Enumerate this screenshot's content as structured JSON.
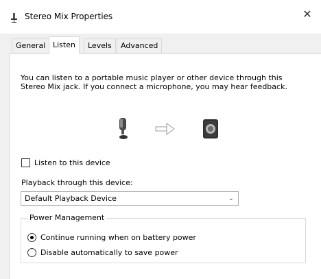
{
  "window": {
    "title": "Stereo Mix Properties",
    "close_label": "✕"
  },
  "tabs": [
    {
      "label": "General"
    },
    {
      "label": "Listen",
      "active": true
    },
    {
      "label": "Levels"
    },
    {
      "label": "Advanced"
    }
  ],
  "listen": {
    "description": "You can listen to a portable music player or other device through this Stereo Mix jack.  If you connect a microphone, you may hear feedback.",
    "illustration_icons": [
      "microphone-icon",
      "arrow-right-icon",
      "speaker-icon"
    ],
    "listen_checkbox_label": "Listen to this device",
    "listen_checked": false,
    "playback_label": "Playback through this device:",
    "playback_device": "Default Playback Device",
    "power_management": {
      "legend": "Power Management",
      "option_continue": "Continue running when on battery power",
      "option_disable": "Disable automatically to save power",
      "selected": "continue"
    }
  }
}
